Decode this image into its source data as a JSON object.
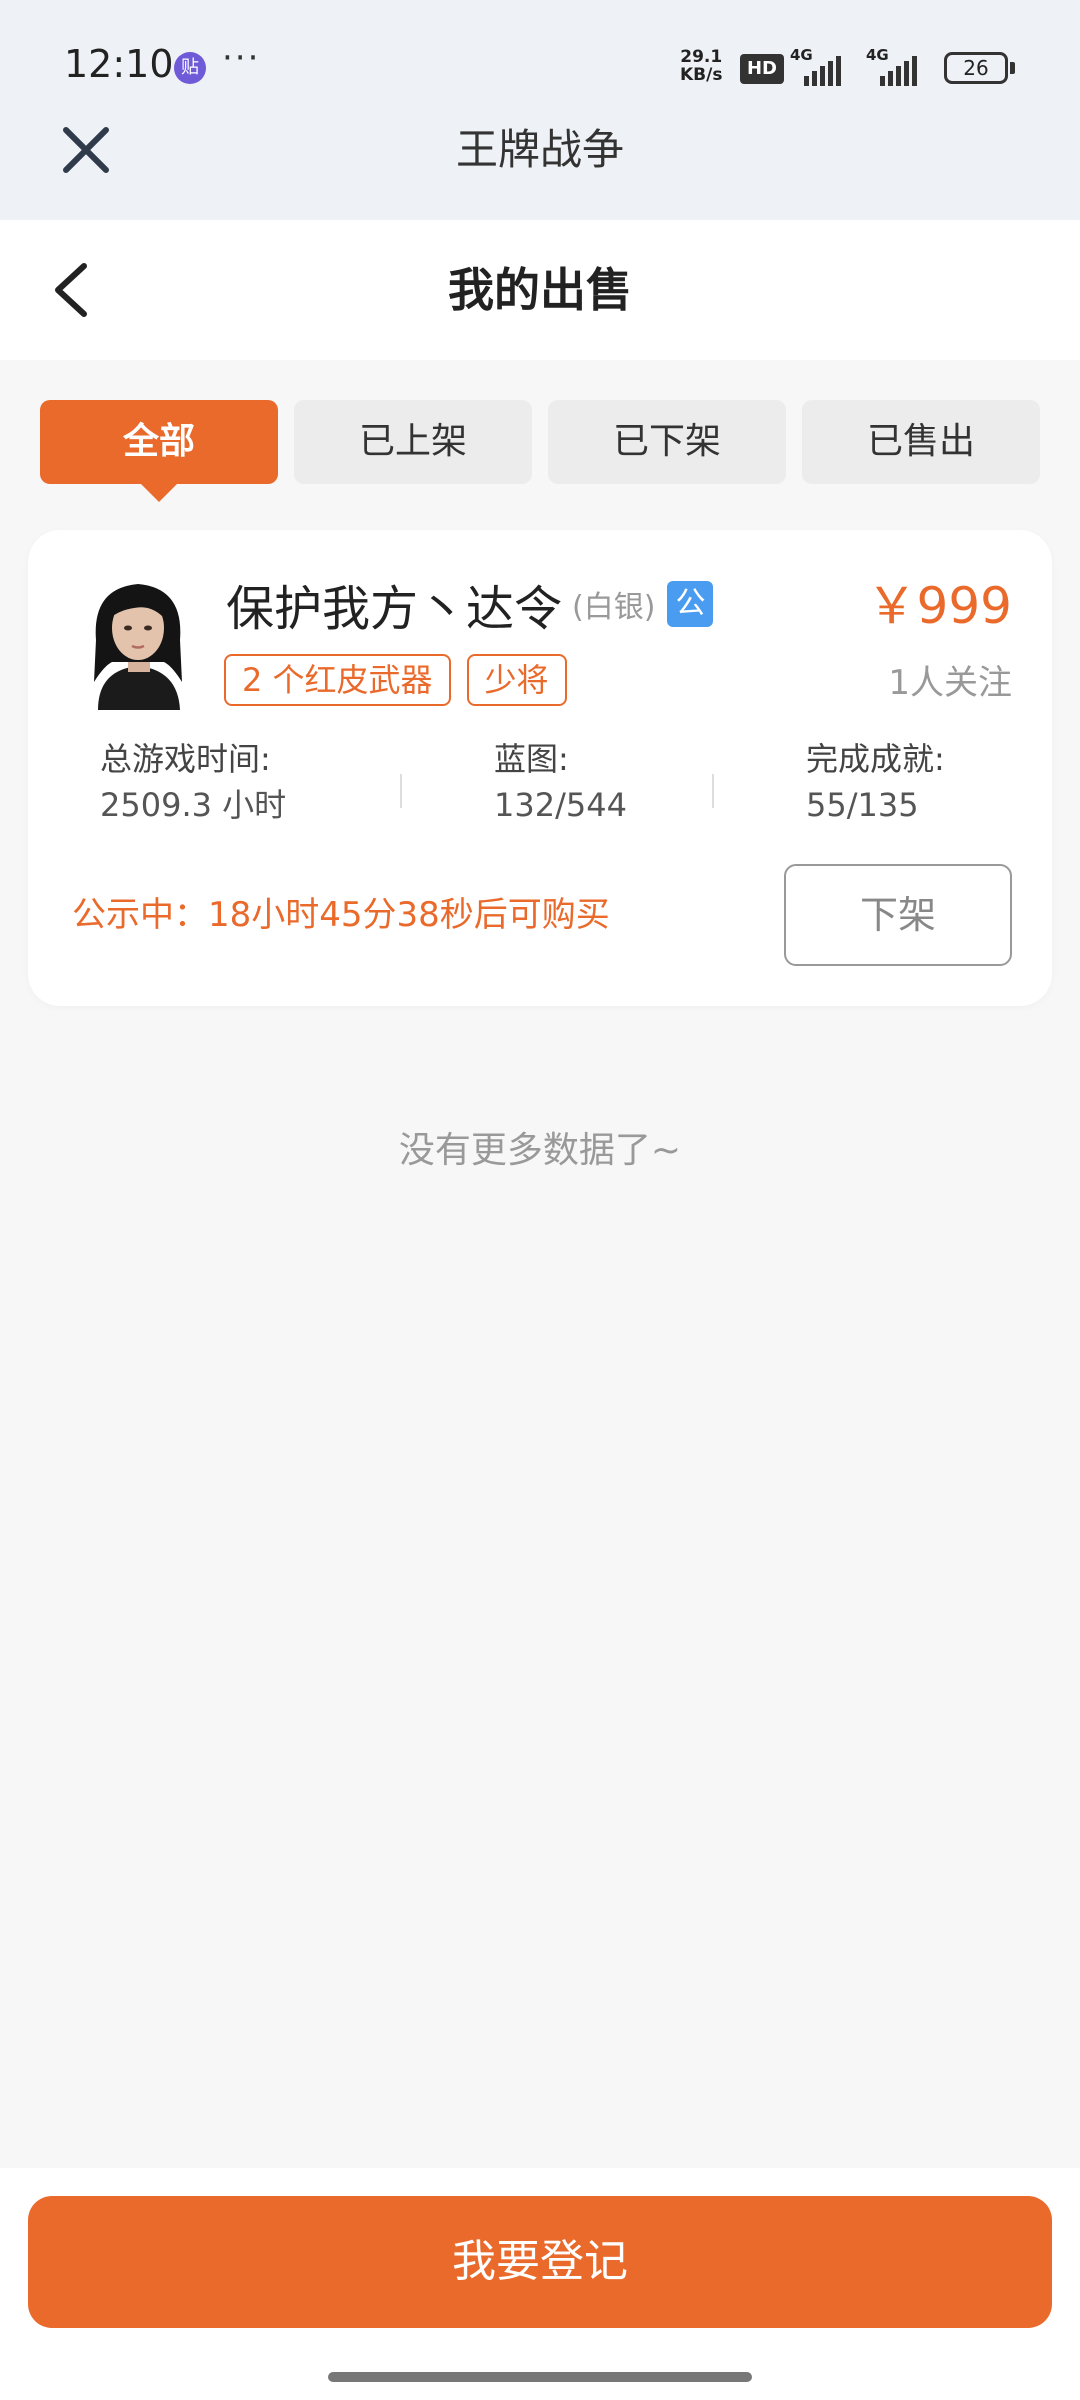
{
  "status_bar": {
    "time": "12:10",
    "app_icon_label": "贴",
    "more_dots": "···",
    "net_speed_value": "29.1",
    "net_speed_unit": "KB/s",
    "hd_label": "HD",
    "sim1_label": "4G",
    "sim2_label": "4G",
    "battery": "26"
  },
  "app_bar": {
    "title": "王牌战争",
    "close_icon": "close-icon"
  },
  "header": {
    "title": "我的出售",
    "back_icon": "chevron-left-icon"
  },
  "tabs": [
    {
      "label": "全部",
      "active": true
    },
    {
      "label": "已上架",
      "active": false
    },
    {
      "label": "已下架",
      "active": false
    },
    {
      "label": "已售出",
      "active": false
    }
  ],
  "listing": {
    "name": "保护我方丶达令",
    "rank": "(白银)",
    "public_badge": "公",
    "price": "￥999",
    "tags": [
      "2 个红皮武器",
      "少将"
    ],
    "followers": "1人关注",
    "stats": [
      {
        "label": "总游戏时间:",
        "value": "2509.3 小时"
      },
      {
        "label": "蓝图:",
        "value": "132/544"
      },
      {
        "label": "完成成就:",
        "value": "55/135"
      }
    ],
    "countdown": "公示中：18小时45分38秒后可购买",
    "delist_label": "下架"
  },
  "no_more_text": "没有更多数据了~",
  "register_button": "我要登记",
  "colors": {
    "accent": "#ea6a2c",
    "badge_blue": "#4a9cf0",
    "background": "#f7f7f7"
  }
}
